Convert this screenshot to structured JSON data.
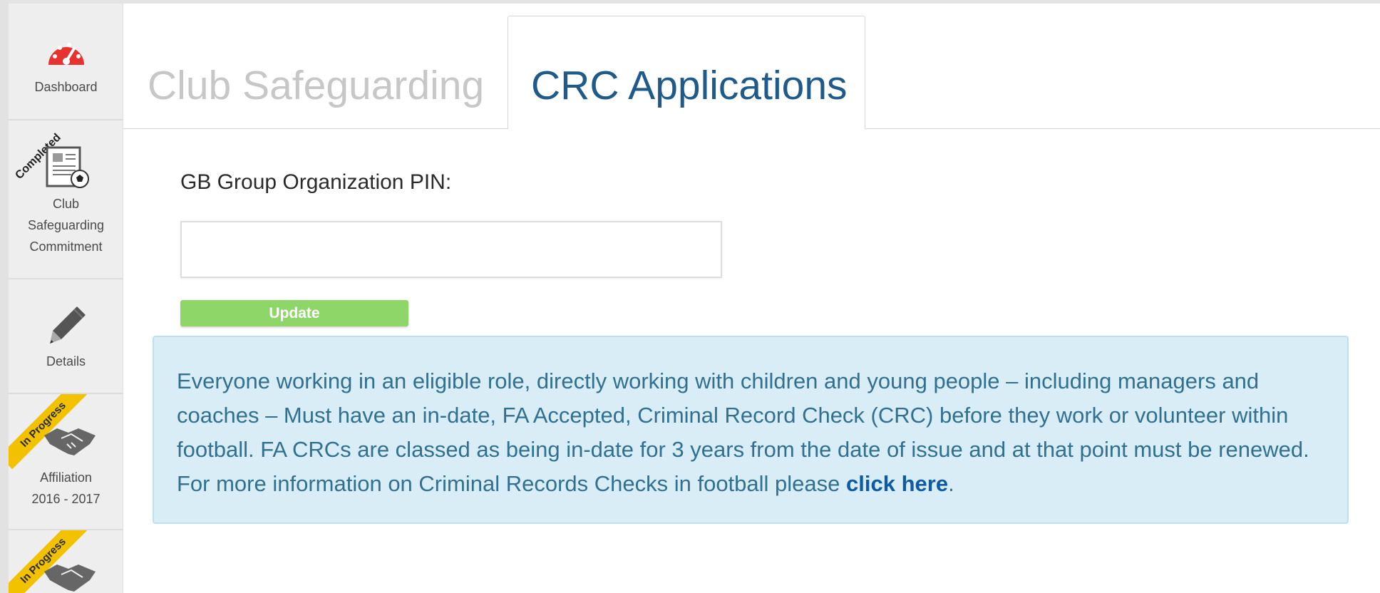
{
  "sidebar": {
    "items": [
      {
        "label": "Dashboard",
        "icon": "dashboard-gauge-icon"
      },
      {
        "label_lines": [
          "Club",
          "Safeguarding",
          "Commitment"
        ],
        "badge": "Completed",
        "icon": "safeguarding-document-icon"
      },
      {
        "label": "Details",
        "icon": "pencil-icon"
      },
      {
        "label_lines": [
          "Affiliation",
          "2016 - 2017"
        ],
        "badge": "In Progress",
        "icon": "handshake-icon"
      },
      {
        "badge": "In Progress",
        "icon": "handshake-icon"
      }
    ]
  },
  "tabs": [
    {
      "label": "Club Safeguarding",
      "active": false
    },
    {
      "label": "CRC Applications",
      "active": true
    }
  ],
  "form": {
    "pin_label": "GB Group Organization PIN:",
    "pin_value": "",
    "update_label": "Update"
  },
  "info": {
    "text": "Everyone working in an eligible role, directly working with children and young people – including managers and coaches – Must have an in-date, FA Accepted, Criminal Record Check (CRC) before they work or volunteer within football. FA CRCs are classed as being in-date for 3 years from the date of issue and at that point must be renewed. For more information on Criminal Records Checks in football please ",
    "link_label": "click here",
    "trailing": "."
  },
  "colors": {
    "accent": "#1e5a8a",
    "button": "#8fd668",
    "info_bg": "#d9edf7",
    "info_text": "#31708f",
    "dashboard_red": "#e8322f",
    "ribbon_yellow": "#f2c200"
  }
}
